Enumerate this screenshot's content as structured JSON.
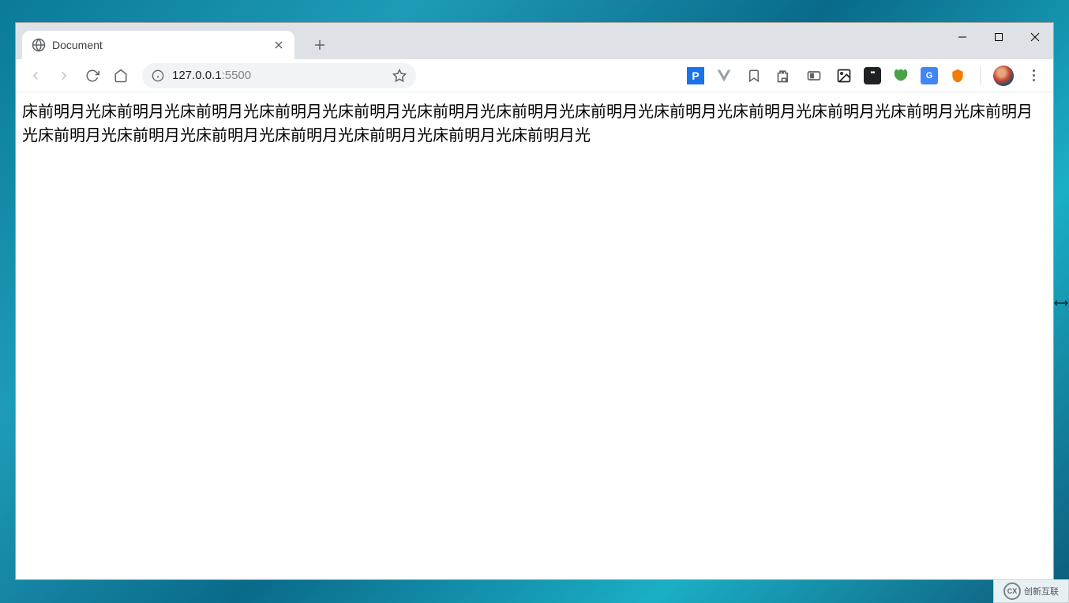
{
  "tab": {
    "title": "Document"
  },
  "omnibox": {
    "host": "127.0.0.1",
    "port": ":5500"
  },
  "content": {
    "text": "床前明月光床前明月光床前明月光床前明月光床前明月光床前明月光床前明月光床前明月光床前明月光床前明月光床前明月光床前明月光床前明月光床前明月光床前明月光床前明月光床前明月光床前明月光床前明月光床前明月光"
  },
  "extensions": {
    "p_label": "P",
    "translate_label": "G",
    "dots_label": "••"
  },
  "watermark": {
    "logo": "CX",
    "text": "创新互联"
  }
}
